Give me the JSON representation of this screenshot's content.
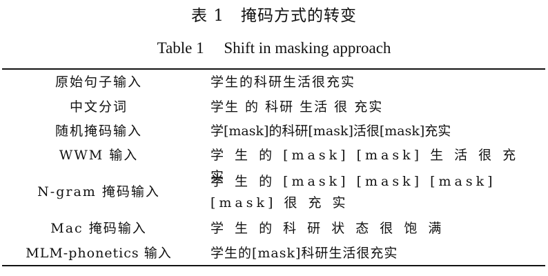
{
  "caption": {
    "zh": "表 1　掩码方式的转变",
    "en": "Table 1　 Shift in masking approach"
  },
  "table": {
    "rows": [
      {
        "label": "原始句子输入",
        "value": "学生的科研生活很充实"
      },
      {
        "label": "中文分词",
        "value": "学生 的 科研 生活 很 充实"
      },
      {
        "label": "随机掩码输入",
        "value": "学[mask]的科研[mask]活很[mask]充实"
      },
      {
        "label": "WWM 输入",
        "value": "学 生 的 [mask] [mask] 生 活 很 充 实"
      },
      {
        "label": "N-gram 掩码输入",
        "value": "学 生 的 [mask] [mask] [mask] [mask] 很 充 实"
      },
      {
        "label": "Mac 掩码输入",
        "value": "学 生 的 科 研 状 态 很 饱 满"
      },
      {
        "label": "MLM-phonetics 输入",
        "value": "学生的[mask]科研生活很充实"
      }
    ]
  }
}
